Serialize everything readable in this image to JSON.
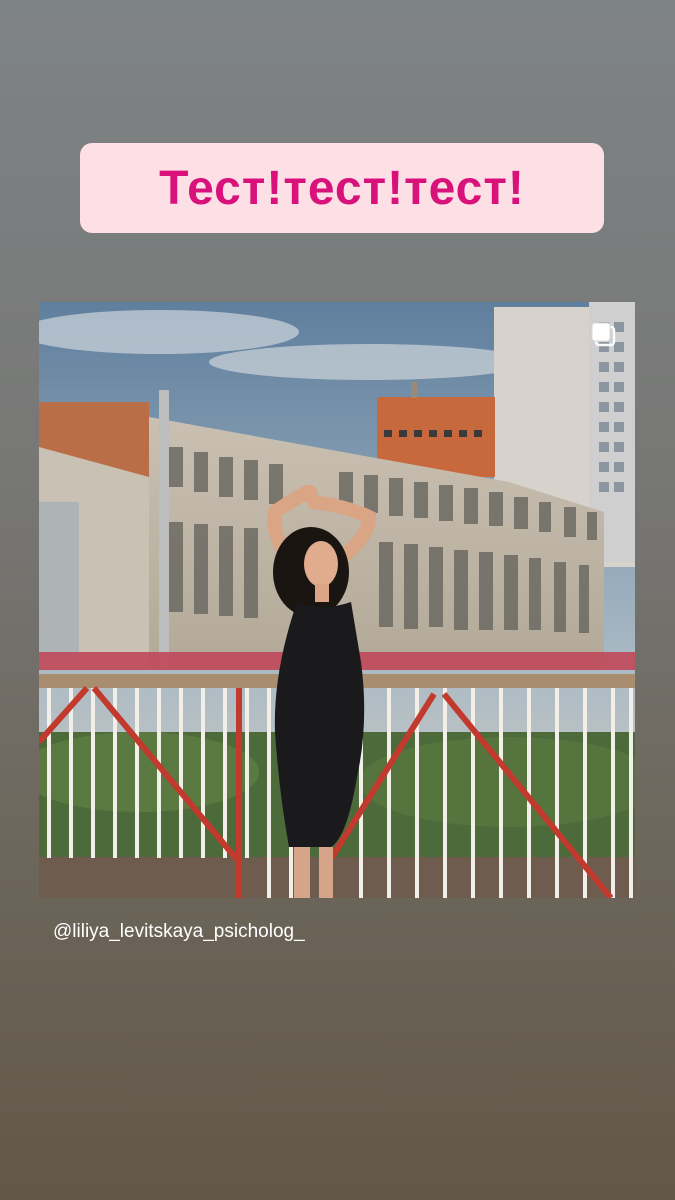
{
  "sticker": {
    "text": "Тест!тест!тест!"
  },
  "post": {
    "username": "@liliya_levitskaya_psicholog_",
    "icon": "multiple-photos-icon"
  },
  "colors": {
    "sticker_bg": "#fde0e6",
    "sticker_text": "#d9117a",
    "caption_text": "#ffffff"
  }
}
